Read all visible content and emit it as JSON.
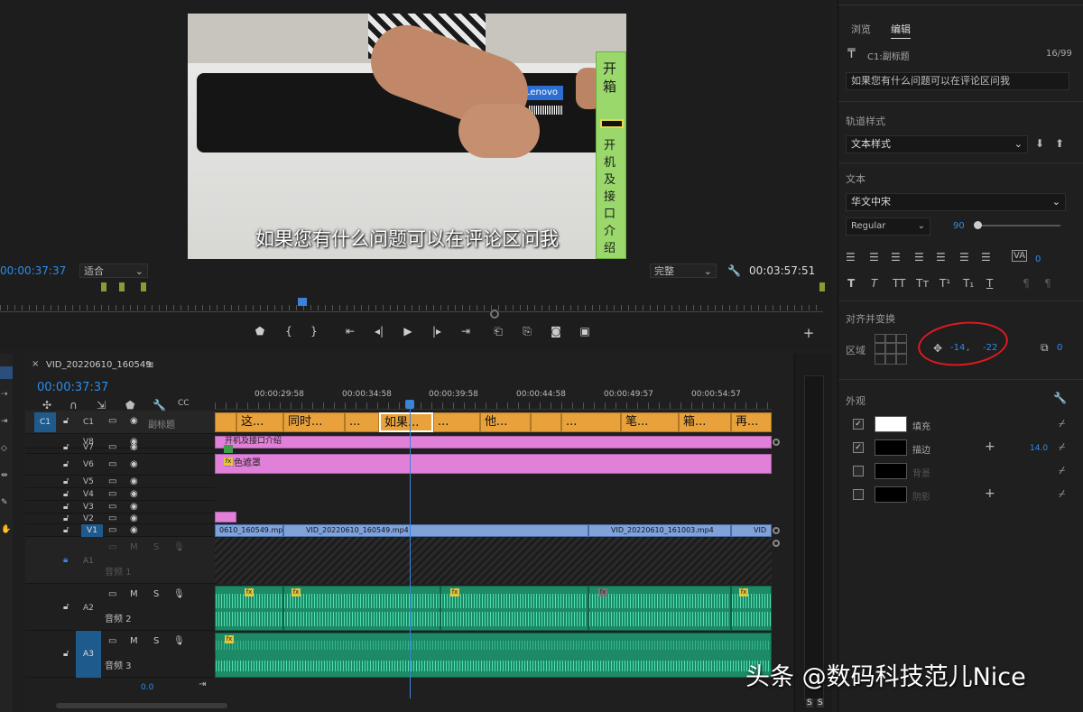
{
  "monitor": {
    "subtitle": "如果您有什么问题可以在评论区问我",
    "vertical_title_top": "开箱",
    "vertical_title_bottom": "开机及接口介绍",
    "product_logo": "Lenovo",
    "current_time": "00:00:37:37",
    "fit_label": "适合",
    "quality_label": "完整",
    "duration": "00:03:57:51"
  },
  "essential_graphics": {
    "tabs": [
      "浏览",
      "编辑"
    ],
    "active_tab": "编辑",
    "layer_name": "C1:副标题",
    "char_count": "16/99",
    "text_value": "如果您有什么问题可以在评论区问我",
    "track_style_label": "轨道样式",
    "track_style_value": "文本样式",
    "text_section": "文本",
    "font_family": "华文中宋",
    "font_style": "Regular",
    "font_size": "90",
    "tracking": "0",
    "align_section": "对齐并变换",
    "region_label": "区域",
    "pos_x": "-14",
    "pos_y": "-22",
    "rotation": "0",
    "appearance_label": "外观",
    "fill_label": "填充",
    "stroke_label": "描边",
    "stroke_width": "14.0",
    "background_label": "背景",
    "shadow_label": "阴影"
  },
  "timeline": {
    "sequence_name": "VID_20220610_160549",
    "timecode": "00:00:37:37",
    "ruler": [
      "00:00:29:58",
      "00:00:34:58",
      "00:00:39:58",
      "00:00:44:58",
      "00:00:49:57",
      "00:00:54:57"
    ],
    "caption_track_label": "C1",
    "caption_track_name": "副标题",
    "captions": [
      "这...",
      "同时...",
      "...",
      "如果...",
      "...",
      "他...",
      "",
      "...",
      "笔...",
      "箱...",
      "再..."
    ],
    "video_tracks": [
      "V8",
      "V7",
      "V6",
      "V5",
      "V4",
      "V3",
      "V2",
      "V1"
    ],
    "pink_clip_1": "开机及接口介绍",
    "pink_clip_2": "颜色遮罩",
    "v1_clips": [
      "0610_160549.mp4",
      "VID_20220610_160549.mp4",
      "VID_20220610_161003.mp4",
      "VID"
    ],
    "audio_tracks": [
      {
        "id": "A1",
        "name": "音频 1"
      },
      {
        "id": "A2",
        "name": "音频 2"
      },
      {
        "id": "A3",
        "name": "音频 3"
      }
    ],
    "master_value": "0.0",
    "m": "M",
    "s": "S"
  },
  "watermark": "头条 @数码科技范儿Nice",
  "annotation_color": "#e2191e",
  "accent": "#2d8ceb"
}
